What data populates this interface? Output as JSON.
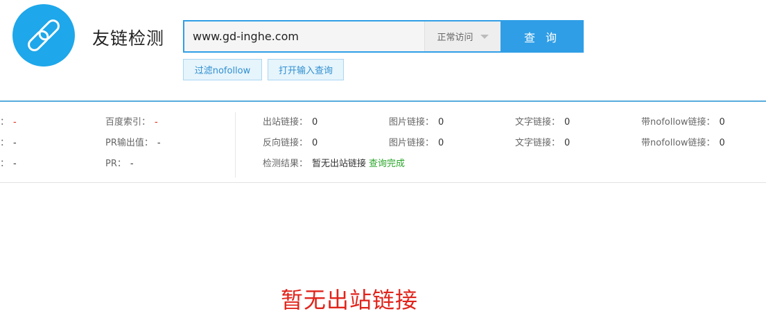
{
  "header": {
    "logo_icon": "link-icon",
    "accent_color": "#2f9ee6",
    "title": "友链检测"
  },
  "search": {
    "value": "www.gd-inghe.com",
    "mode_selected": "正常访问",
    "submit_label": "查 询"
  },
  "options": {
    "filter_nofollow": "过滤nofollow",
    "open_input_query": "打开输入查询"
  },
  "stats_left": [
    {
      "label": "：",
      "value": "-",
      "value_red": true
    },
    {
      "label": "：",
      "value": "-",
      "value_red": false
    },
    {
      "label": "：",
      "value": "-",
      "value_red": false
    }
  ],
  "stats_mid": [
    {
      "label": "百度索引：",
      "value": "-",
      "value_red": true
    },
    {
      "label": "PR输出值：",
      "value": "-",
      "value_red": false
    },
    {
      "label": "PR：",
      "value": "-",
      "value_red": false
    }
  ],
  "links_row1": [
    {
      "label": "出站链接：",
      "value": "0"
    },
    {
      "label": "图片链接：",
      "value": "0"
    },
    {
      "label": "文字链接：",
      "value": "0"
    },
    {
      "label": "带nofollow链接：",
      "value": "0"
    }
  ],
  "links_row2": [
    {
      "label": "反向链接：",
      "value": "0"
    },
    {
      "label": "图片链接：",
      "value": "0"
    },
    {
      "label": "文字链接：",
      "value": "0"
    },
    {
      "label": "带nofollow链接：",
      "value": "0"
    }
  ],
  "result": {
    "label": "检测结果：",
    "value": "暂无出站链接",
    "status": "查询完成",
    "status_color": "#2aa52a"
  },
  "empty_message": "暂无出站链接"
}
